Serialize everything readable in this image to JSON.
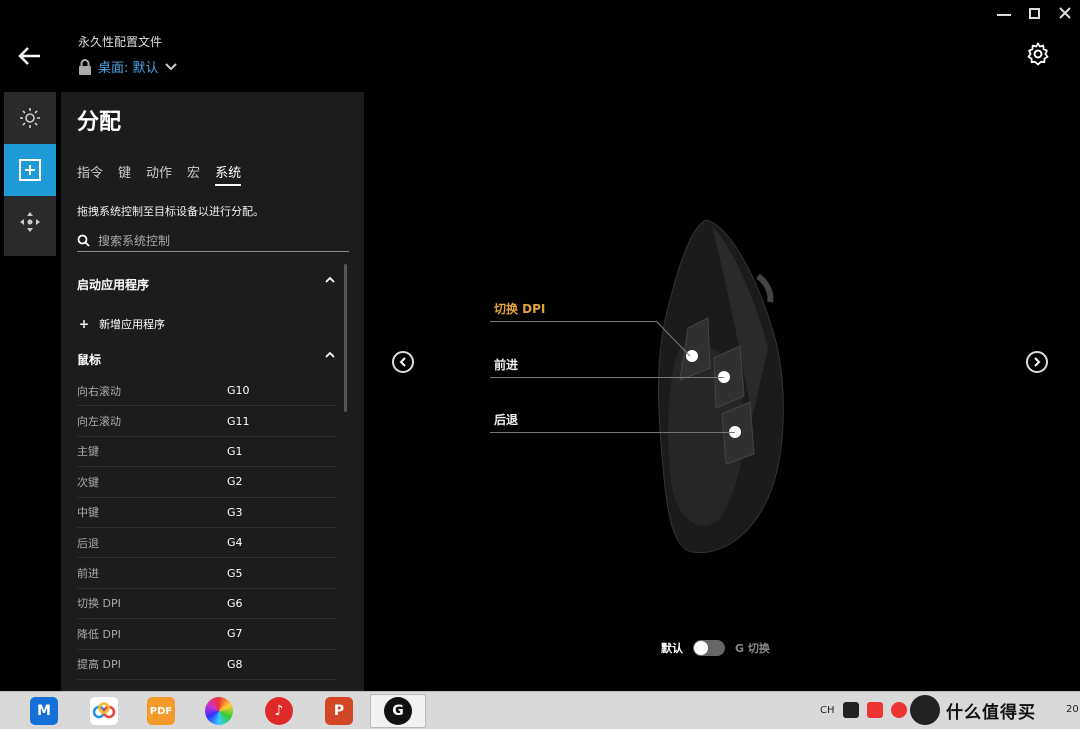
{
  "header": {
    "profile_title": "永久性配置文件",
    "profile_selected": "桌面: 默认"
  },
  "panel": {
    "title": "分配",
    "tabs": [
      {
        "label": "指令",
        "active": false
      },
      {
        "label": "键",
        "active": false
      },
      {
        "label": "动作",
        "active": false
      },
      {
        "label": "宏",
        "active": false
      },
      {
        "label": "系统",
        "active": true
      }
    ],
    "hint": "拖拽系统控制至目标设备以进行分配。",
    "search_placeholder": "搜索系统控制",
    "section_apps": "启动应用程序",
    "add_app": "新增应用程序",
    "section_mouse": "鼠标",
    "rows": [
      {
        "label": "向右滚动",
        "key": "G10"
      },
      {
        "label": "向左滚动",
        "key": "G11"
      },
      {
        "label": "主键",
        "key": "G1"
      },
      {
        "label": "次键",
        "key": "G2"
      },
      {
        "label": "中键",
        "key": "G3"
      },
      {
        "label": "后退",
        "key": "G4"
      },
      {
        "label": "前进",
        "key": "G5"
      },
      {
        "label": "切换 DPI",
        "key": "G6"
      },
      {
        "label": "降低 DPI",
        "key": "G7"
      },
      {
        "label": "提高 DPI",
        "key": "G8"
      }
    ]
  },
  "device": {
    "assignments": [
      {
        "label": "切换 DPI",
        "highlight": true
      },
      {
        "label": "前进",
        "highlight": false
      },
      {
        "label": "后退",
        "highlight": false
      }
    ]
  },
  "toggle": {
    "left_label": "默认",
    "right_label": "G 切换",
    "state": "默认"
  },
  "taskbar": {
    "tray_lang": "CH",
    "clock_fragment": "20",
    "watermark": "什么值得买",
    "apps": [
      "maxthon",
      "baidu-netdisk",
      "pdf",
      "color",
      "netease-music",
      "powerpoint",
      "logitech-g"
    ]
  },
  "colors": {
    "accent": "#1e9bd7",
    "highlight": "#e0a43a",
    "link": "#4aa3e0"
  }
}
